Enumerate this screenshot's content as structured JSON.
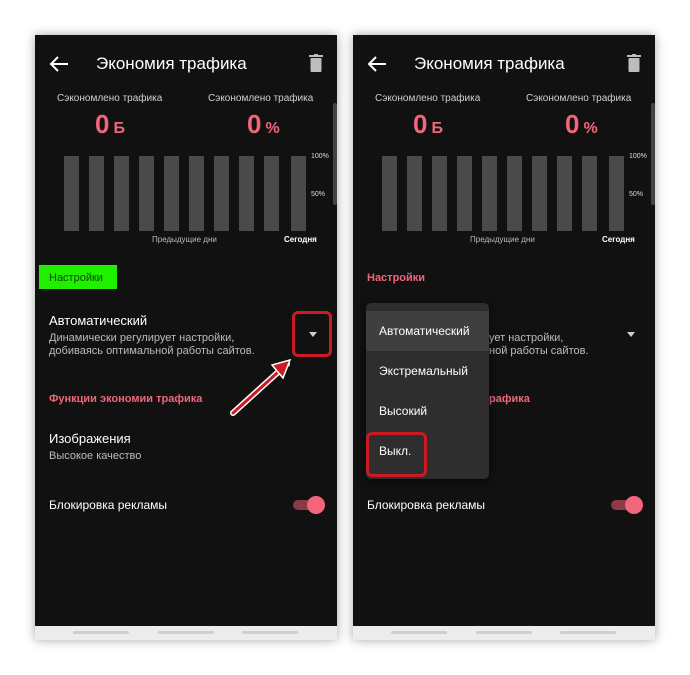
{
  "title": "Экономия трафика",
  "stats": {
    "left_label": "Сэкономлено трафика",
    "left_value": "0",
    "left_unit": "Б",
    "right_label": "Сэкономлено трафика",
    "right_value": "0",
    "right_unit": "%"
  },
  "chart": {
    "label_100": "100%",
    "label_50": "50%",
    "prev_days": "Предыдущие дни",
    "today": "Сегодня"
  },
  "settings_header": "Настройки",
  "mode": {
    "title": "Автоматический",
    "desc_line1": "Динамически регулирует настройки,",
    "desc_line2": "добиваясь оптимальной работы сайтов.",
    "desc_line1_partial": "ует настройки,",
    "desc_line2_partial": "ной работы сайтов."
  },
  "functions_header": "Функции экономии трафика",
  "functions_header_partial": "рафика",
  "images": {
    "title": "Изображения",
    "value": "Высокое качество"
  },
  "ad_block": {
    "label": "Блокировка рекламы",
    "enabled": true
  },
  "dropdown": {
    "options": [
      "Автоматический",
      "Экстремальный",
      "Высокий",
      "Выкл."
    ],
    "selected": "Автоматический"
  },
  "colors": {
    "accent": "#f2657a",
    "background": "#111111",
    "highlight_green": "#1ef000",
    "annotation_red": "#cc1a22"
  }
}
